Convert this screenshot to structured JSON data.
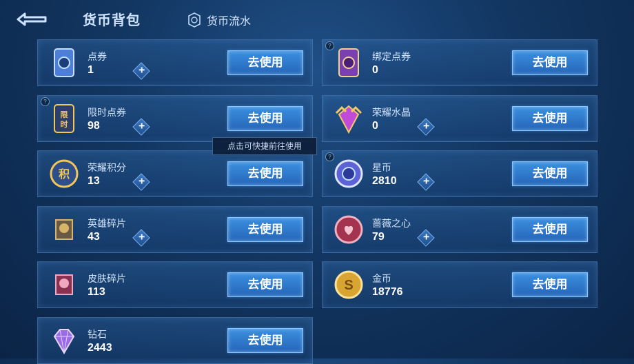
{
  "header": {
    "title": "货币背包",
    "flow_label": "货币流水"
  },
  "tooltip": "点击可快捷前往使用",
  "items": [
    {
      "name": "点券",
      "count": "1",
      "button": "去使用",
      "has_plus": true,
      "icon": "ticket-icon"
    },
    {
      "name": "绑定点券",
      "count": "0",
      "button": "去使用",
      "has_plus": false,
      "icon": "bound-ticket-icon",
      "help": true
    },
    {
      "name": "限时点券",
      "count": "98",
      "button": "去使用",
      "has_plus": true,
      "icon": "limited-ticket-icon",
      "help": true
    },
    {
      "name": "荣耀水晶",
      "count": "0",
      "button": "去使用",
      "has_plus": true,
      "icon": "glory-crystal-icon"
    },
    {
      "name": "荣耀积分",
      "count": "13",
      "button": "去使用",
      "has_plus": true,
      "icon": "glory-points-icon"
    },
    {
      "name": "星币",
      "count": "2810",
      "button": "去使用",
      "has_plus": true,
      "icon": "star-coin-icon",
      "help": true
    },
    {
      "name": "英雄碎片",
      "count": "43",
      "button": "去使用",
      "has_plus": true,
      "icon": "hero-shard-icon"
    },
    {
      "name": "蔷薇之心",
      "count": "79",
      "button": "去使用",
      "has_plus": true,
      "icon": "rose-heart-icon"
    },
    {
      "name": "皮肤碎片",
      "count": "113",
      "button": "去使用",
      "has_plus": false,
      "icon": "skin-shard-icon"
    },
    {
      "name": "金币",
      "count": "18776",
      "button": "去使用",
      "has_plus": false,
      "icon": "gold-coin-icon"
    },
    {
      "name": "钻石",
      "count": "2443",
      "button": "去使用",
      "has_plus": false,
      "icon": "diamond-icon"
    }
  ],
  "colors": {
    "button_top": "#3b8fe0",
    "button_bottom": "#2565b8",
    "background": "#123661"
  }
}
